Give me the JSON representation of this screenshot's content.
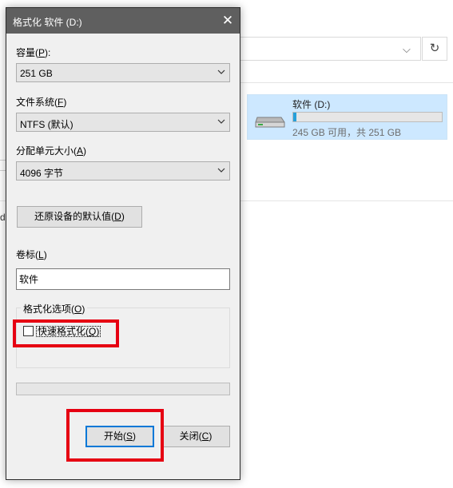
{
  "explorer": {
    "drive": {
      "name": "软件 (D:)",
      "space_text": "245 GB 可用，共 251 GB",
      "used_fraction": 0.024,
      "icon": "hard-drive-icon",
      "bar_color": "#26a0da"
    },
    "left_fragment": "d",
    "address_chevron": "chevron-down-icon",
    "refresh_icon": "refresh-icon",
    "refresh_glyph": "↻"
  },
  "dialog": {
    "title": "格式化 软件 (D:)",
    "close_glyph": "✕",
    "capacity": {
      "label": "容量",
      "key": "P",
      "value": "251 GB"
    },
    "filesystem": {
      "label": "文件系统",
      "key": "F",
      "value": "NTFS (默认)"
    },
    "allocation": {
      "label": "分配单元大小",
      "key": "A",
      "value": "4096 字节"
    },
    "restore_defaults": {
      "label": "还原设备的默认值",
      "key": "D"
    },
    "volume": {
      "label": "卷标",
      "key": "L",
      "value": "软件"
    },
    "format_options": {
      "title": "格式化选项",
      "key": "O",
      "quick_format": {
        "label": "快速格式化",
        "key": "Q",
        "checked": false
      }
    },
    "progress": 0,
    "start_button": {
      "label": "开始",
      "key": "S"
    },
    "close_button": {
      "label": "关闭",
      "key": "C"
    }
  },
  "highlight_color": "#e60012"
}
